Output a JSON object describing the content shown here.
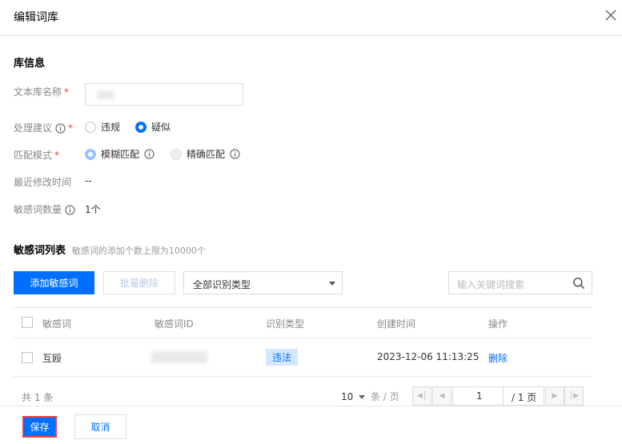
{
  "dialog": {
    "title": "编辑词库"
  },
  "lib_info": {
    "section_title": "库信息",
    "name_label": "文本库名称",
    "required_mark": "*",
    "suggestion_label": "处理建议",
    "suggestion_options": [
      "违规",
      "疑似"
    ],
    "suggestion_selected": "疑似",
    "match_label": "匹配模式",
    "match_options": [
      "模糊匹配",
      "精确匹配"
    ],
    "match_selected": "模糊匹配",
    "modified_label": "最近修改时间",
    "modified_value": "--",
    "count_label": "敏感词数量",
    "count_value": "1个"
  },
  "word_list": {
    "section_title": "敏感词列表",
    "section_hint": "敏感词的添加个数上限为10000个",
    "add_button": "添加敏感词",
    "batch_delete_button": "批量删除",
    "type_filter_value": "全部识别类型",
    "search_placeholder": "输入关键词搜索",
    "columns": [
      "敏感词",
      "敏感词ID",
      "识别类型",
      "创建时间",
      "操作"
    ],
    "rows": [
      {
        "word": "互殴",
        "id": "",
        "type": "违法",
        "created": "2023-12-06 11:13:25",
        "action": "删除"
      }
    ],
    "pagination": {
      "total_text": "共 1 条",
      "page_size": "10",
      "page_size_unit": "条 / 页",
      "current_page": "1",
      "total_pages": "/ 1 页"
    }
  },
  "footer": {
    "save_button": "保存",
    "cancel_button": "取消"
  },
  "colors": {
    "primary": "#006eff",
    "danger": "#e54545",
    "tag_bg": "#d5e7ff"
  },
  "icons": [
    "close-icon",
    "info-icon",
    "search-icon",
    "chevron-down-icon",
    "first-page-icon",
    "prev-page-icon",
    "next-page-icon",
    "last-page-icon"
  ]
}
